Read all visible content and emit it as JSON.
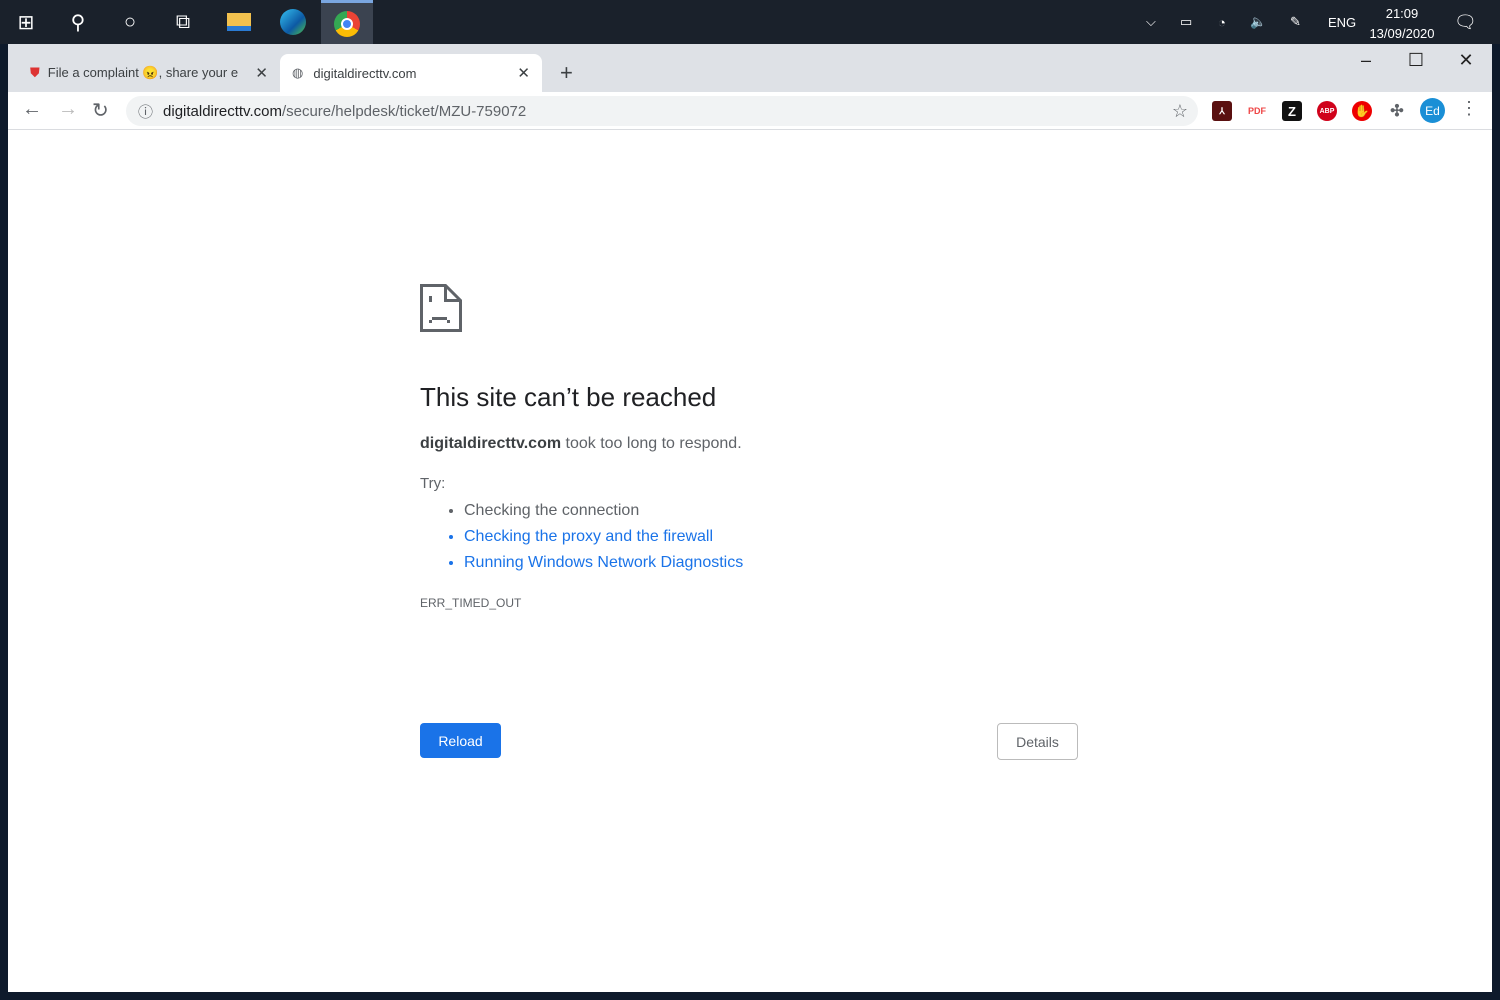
{
  "taskbar": {
    "time": "21:09",
    "date": "13/09/2020",
    "lang": "ENG"
  },
  "tabs": [
    {
      "title": "File a complaint 😠, share your e"
    },
    {
      "title": "digitaldirecttv.com"
    }
  ],
  "address": {
    "host": "digitaldirecttv.com",
    "path": "/secure/helpdesk/ticket/MZU-759072"
  },
  "extensions": {
    "pdf": "PDF",
    "abp": "ABP",
    "z": "Z",
    "profile": "Ed"
  },
  "error": {
    "title": "This site can’t be reached",
    "host": "digitaldirecttv.com",
    "message": " took too long to respond.",
    "try_label": "Try:",
    "suggestions": [
      "Checking the connection",
      "Checking the proxy and the firewall",
      "Running Windows Network Diagnostics"
    ],
    "code": "ERR_TIMED_OUT",
    "reload_label": "Reload",
    "details_label": "Details"
  }
}
